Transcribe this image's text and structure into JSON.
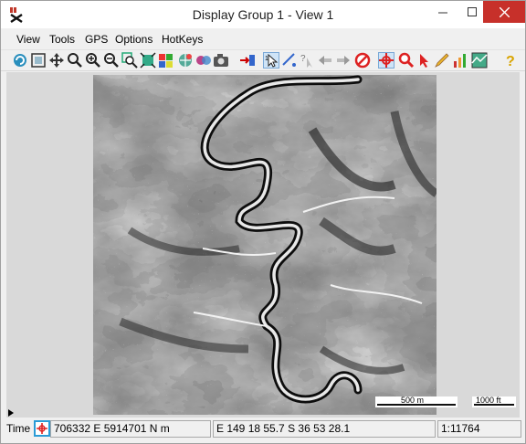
{
  "window": {
    "title": "Display Group 1 - View 1"
  },
  "menu": [
    "View",
    "Tools",
    "GPS",
    "Options",
    "HotKeys"
  ],
  "toolbar_icons": [
    "redraw-icon",
    "full-view-icon",
    "pan-icon",
    "zoom-extent-icon",
    "zoom-in-icon",
    "zoom-out-icon",
    "zoom-box-icon",
    "zoom-fit-icon",
    "layer-controls-icon",
    "spatial-data-icon",
    "snapshot-icon",
    "add-layer-icon",
    "select-tool-icon",
    "measure-icon",
    "help-cursor-icon",
    "back-icon",
    "forward-icon",
    "cancel-icon",
    "crosshair-icon",
    "zoom-magnifier-icon",
    "pointer-icon",
    "edit-pen-icon",
    "settings-icon",
    "raster-icon",
    "help-icon"
  ],
  "scalebar": {
    "metric_label": "500 m",
    "imperial_label": "1000 ft"
  },
  "status": {
    "time_label": "Time",
    "coords_projected": "706332 E  5914701 N m",
    "coords_geographic": "E 149 18 55.7  S 36 53 28.1",
    "scale": "1:11764"
  }
}
